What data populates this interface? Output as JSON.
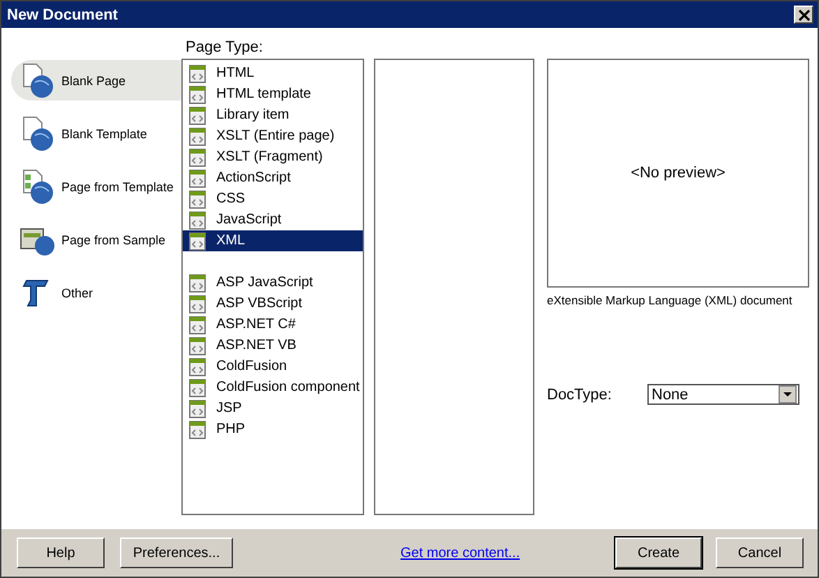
{
  "window": {
    "title": "New Document"
  },
  "categories": [
    {
      "label": "Blank Page",
      "selected": true,
      "kind": "page"
    },
    {
      "label": "Blank Template",
      "selected": false,
      "kind": "template"
    },
    {
      "label": "Page from Template",
      "selected": false,
      "kind": "from-template"
    },
    {
      "label": "Page from Sample",
      "selected": false,
      "kind": "sample"
    },
    {
      "label": "Other",
      "selected": false,
      "kind": "other"
    }
  ],
  "page_type": {
    "label": "Page Type:",
    "groups": [
      [
        {
          "label": "HTML",
          "selected": false
        },
        {
          "label": "HTML template",
          "selected": false
        },
        {
          "label": "Library item",
          "selected": false
        },
        {
          "label": "XSLT (Entire page)",
          "selected": false
        },
        {
          "label": "XSLT (Fragment)",
          "selected": false
        },
        {
          "label": "ActionScript",
          "selected": false
        },
        {
          "label": "CSS",
          "selected": false
        },
        {
          "label": "JavaScript",
          "selected": false
        },
        {
          "label": "XML",
          "selected": true
        }
      ],
      [
        {
          "label": "ASP JavaScript",
          "selected": false
        },
        {
          "label": "ASP VBScript",
          "selected": false
        },
        {
          "label": "ASP.NET C#",
          "selected": false
        },
        {
          "label": "ASP.NET VB",
          "selected": false
        },
        {
          "label": "ColdFusion",
          "selected": false
        },
        {
          "label": "ColdFusion component",
          "selected": false
        },
        {
          "label": "JSP",
          "selected": false
        },
        {
          "label": "PHP",
          "selected": false
        }
      ]
    ]
  },
  "preview": {
    "text": "<No preview>",
    "description": "eXtensible Markup Language (XML) document"
  },
  "doctype": {
    "label": "DocType:",
    "value": "None"
  },
  "footer": {
    "help": "Help",
    "preferences": "Preferences...",
    "link": "Get more content...",
    "create": "Create",
    "cancel": "Cancel"
  }
}
